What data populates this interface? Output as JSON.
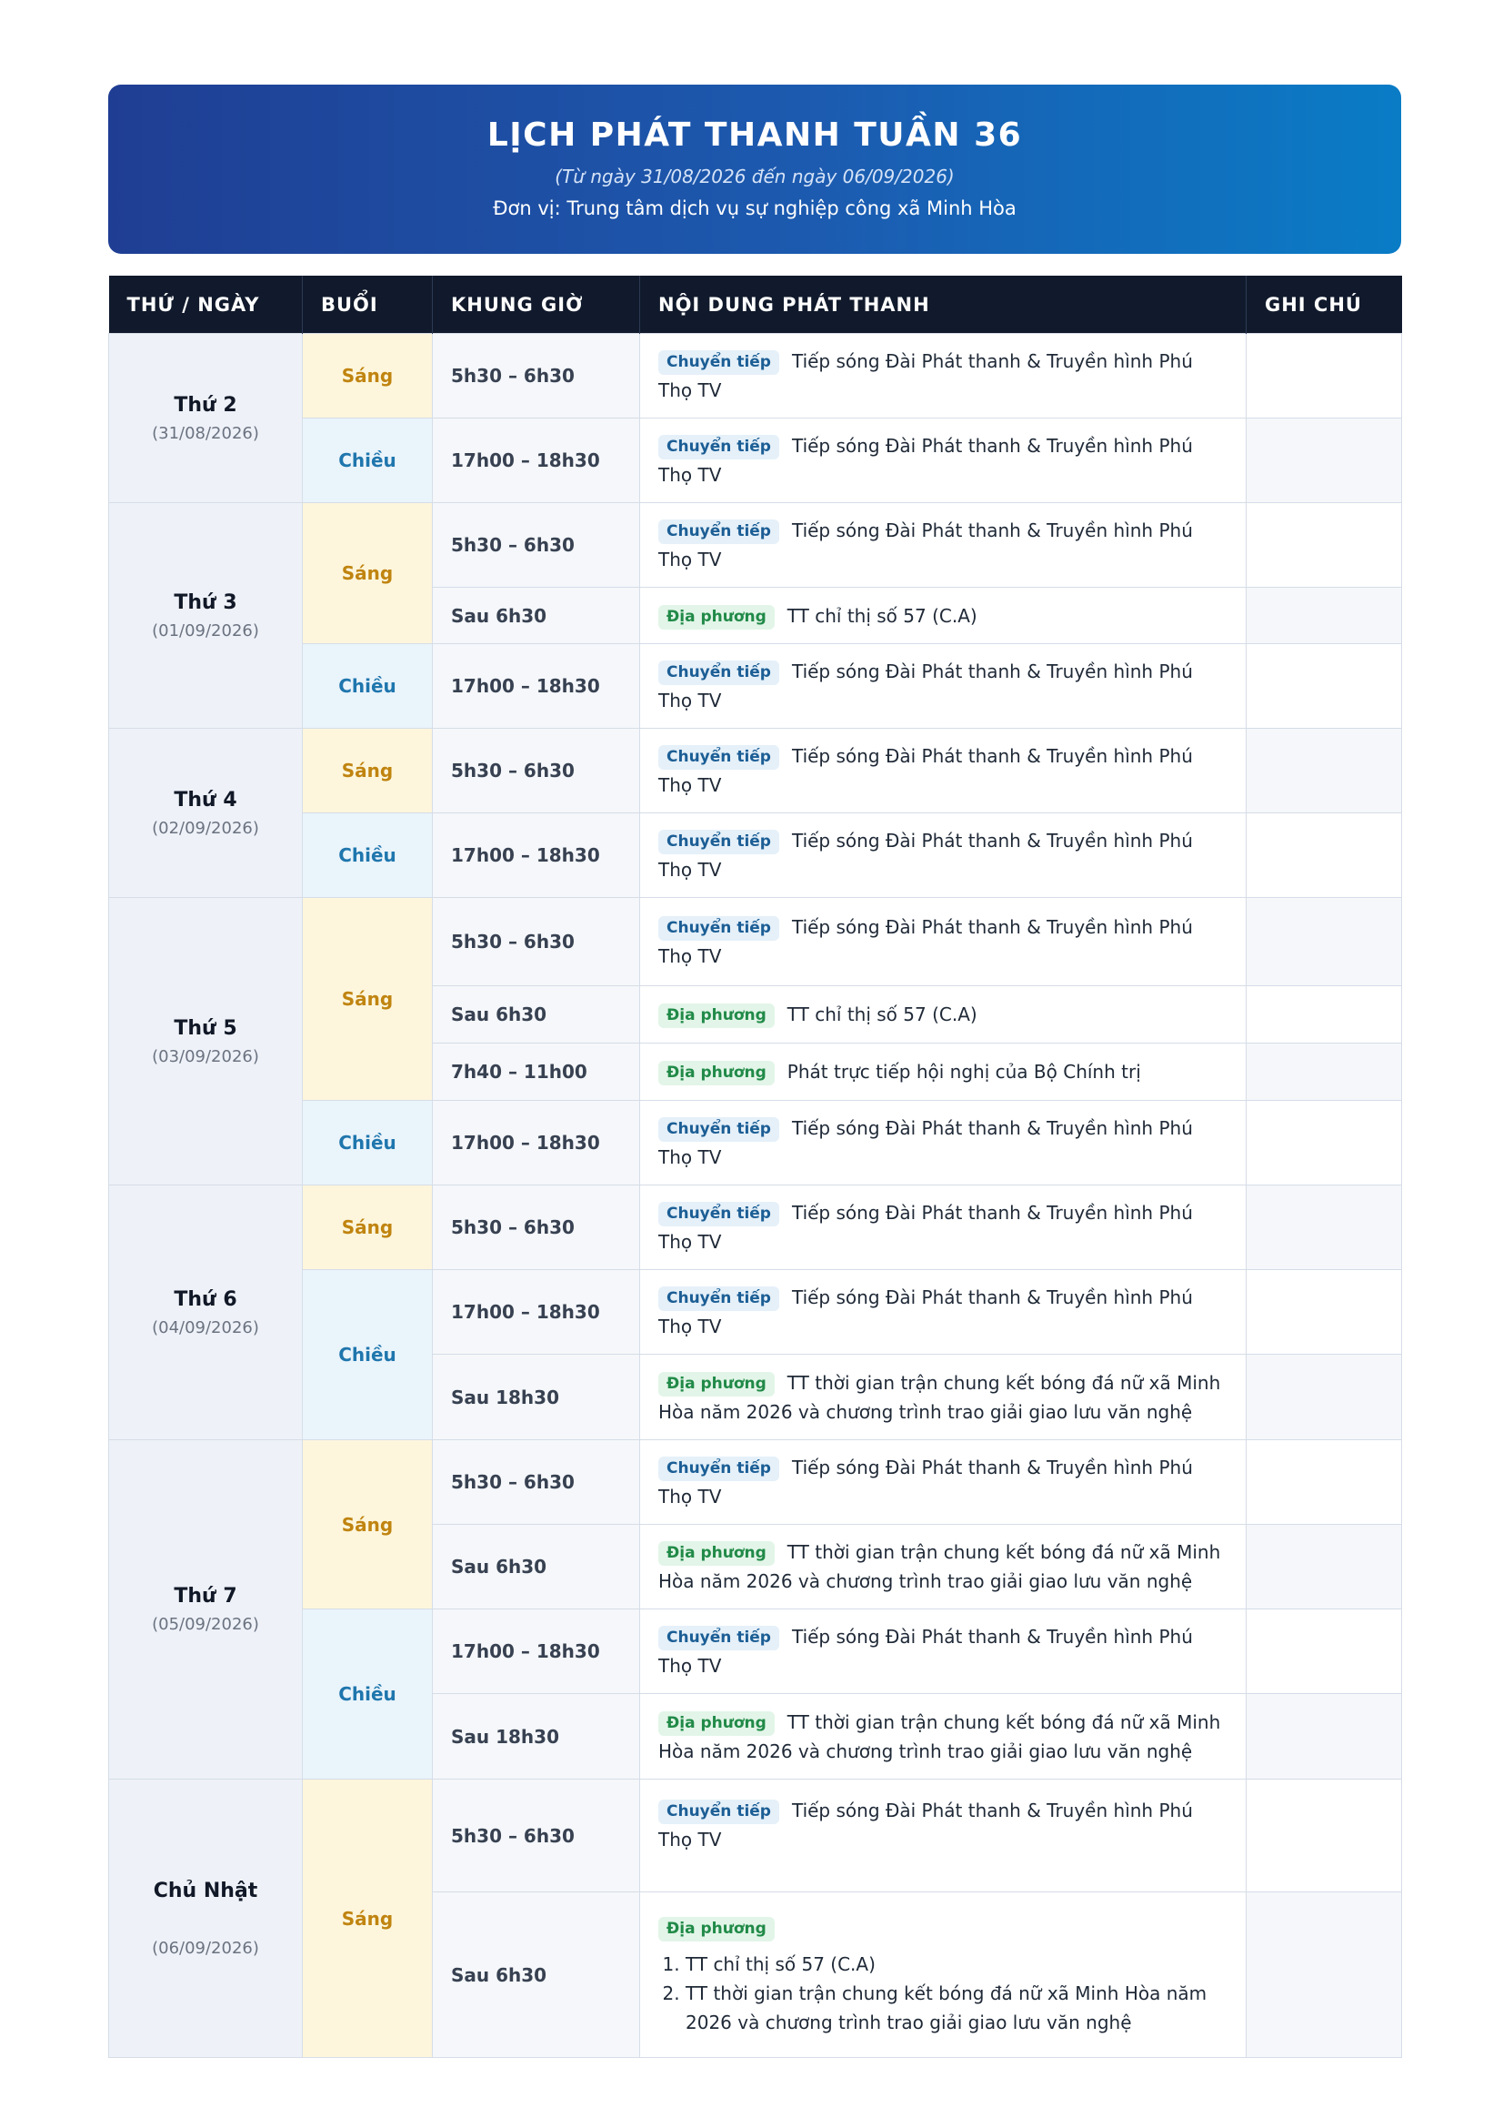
{
  "header": {
    "title": "LỊCH PHÁT THANH TUẦN 36",
    "subtitle": "(Từ ngày 31/08/2026 đến ngày 06/09/2026)",
    "unit": "Đơn vị: Trung tâm dịch vụ sự nghiệp công xã Minh Hòa"
  },
  "columns": [
    "THỨ / NGÀY",
    "BUỔI",
    "KHUNG GIỜ",
    "NỘI DUNG PHÁT THANH",
    "GHI CHÚ"
  ],
  "sessions": {
    "morning": "Sáng",
    "afternoon": "Chiều"
  },
  "tags": {
    "relay": "Chuyển tiếp",
    "local": "Địa phương"
  },
  "texts": {
    "relay": "Tiếp sóng Đài Phát thanh & Truyền hình Phú Thọ TV",
    "ct57": "TT chỉ thị số 57 (C.A)",
    "hoinghi": "Phát trực tiếp hội nghị của Bộ Chính trị",
    "football": "TT thời gian trận chung kết bóng đá nữ xã Minh Hòa năm 2026 và chương trình trao giải giao lưu văn nghệ"
  },
  "times": {
    "t1": "5h30 – 6h30",
    "t2": "17h00 – 18h30",
    "t3": "Sau 6h30",
    "t4": "7h40 – 11h00",
    "t5": "Sau 18h30"
  },
  "days": [
    {
      "name": "Thứ 2",
      "date": "(31/08/2026)"
    },
    {
      "name": "Thứ 3",
      "date": "(01/09/2026)"
    },
    {
      "name": "Thứ 4",
      "date": "(02/09/2026)"
    },
    {
      "name": "Thứ 5",
      "date": "(03/09/2026)"
    },
    {
      "name": "Thứ 6",
      "date": "(04/09/2026)"
    },
    {
      "name": "Thứ 7",
      "date": "(05/09/2026)"
    },
    {
      "name": "Chủ Nhật",
      "date": "(06/09/2026)"
    }
  ]
}
